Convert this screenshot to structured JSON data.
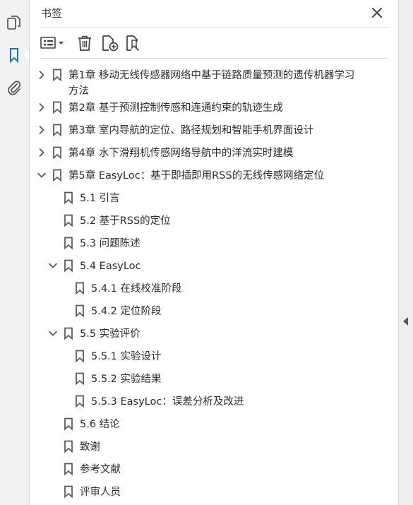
{
  "panel": {
    "title": "书签"
  },
  "rail": {
    "icons": [
      "pages-icon",
      "bookmark-icon",
      "attachment-icon"
    ]
  },
  "toolbar": {
    "icons": [
      "options-menu-icon",
      "delete-icon",
      "new-bookmark-icon",
      "bookmark-search-icon"
    ]
  },
  "bookmarks": [
    {
      "label": "第1章 移动无线传感器网络中基于链路质量预测的遗传机器学习",
      "label_line2": "方法",
      "level": 0,
      "expander": "collapsed"
    },
    {
      "label": "第2章 基于预测控制传感和连通约束的轨迹生成",
      "level": 0,
      "expander": "collapsed"
    },
    {
      "label": "第3章 室内导航的定位、路径规划和智能手机界面设计",
      "level": 0,
      "expander": "collapsed"
    },
    {
      "label": "第4章 水下滑翔机传感网络导航中的洋流实时建模",
      "level": 0,
      "expander": "collapsed"
    },
    {
      "label": "第5章 EasyLoc：基于即插即用RSS的无线传感网络定位",
      "level": 0,
      "expander": "expanded"
    },
    {
      "label": "5.1 引言",
      "level": 1,
      "expander": "none"
    },
    {
      "label": "5.2 基于RSS的定位",
      "level": 1,
      "expander": "none"
    },
    {
      "label": "5.3 问题陈述",
      "level": 1,
      "expander": "none"
    },
    {
      "label": "5.4 EasyLoc",
      "level": 1,
      "expander": "expanded"
    },
    {
      "label": "5.4.1 在线校准阶段",
      "level": 2,
      "expander": "none"
    },
    {
      "label": "5.4.2 定位阶段",
      "level": 2,
      "expander": "none"
    },
    {
      "label": "5.5 实验评价",
      "level": 1,
      "expander": "expanded"
    },
    {
      "label": "5.5.1 实验设计",
      "level": 2,
      "expander": "none"
    },
    {
      "label": "5.5.2 实验结果",
      "level": 2,
      "expander": "none"
    },
    {
      "label": "5.5.3 EasyLoc：误差分析及改进",
      "level": 2,
      "expander": "none"
    },
    {
      "label": "5.6 结论",
      "level": 1,
      "expander": "none"
    },
    {
      "label": "致谢",
      "level": 1,
      "expander": "none"
    },
    {
      "label": "参考文献",
      "level": 1,
      "expander": "none"
    },
    {
      "label": "评审人员",
      "level": 1,
      "expander": "none"
    }
  ]
}
